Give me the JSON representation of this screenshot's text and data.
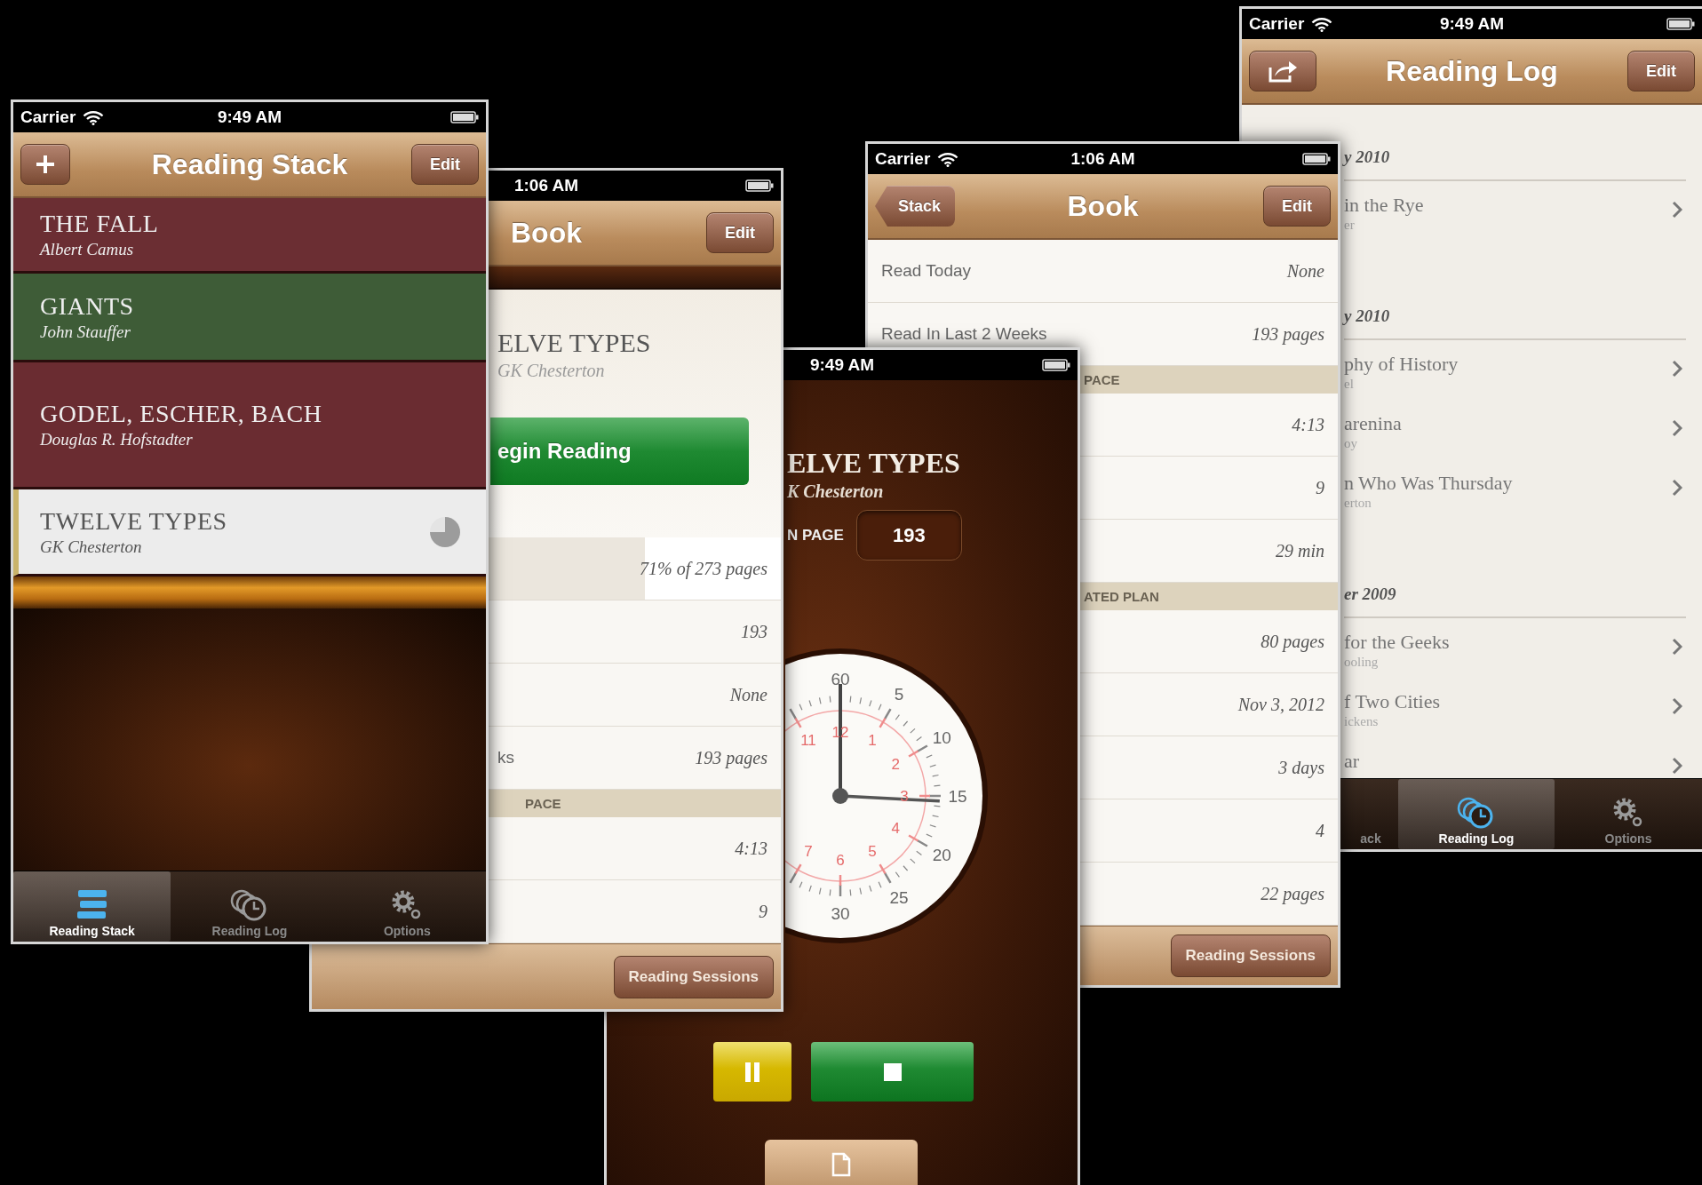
{
  "reading_stack": {
    "status": {
      "carrier": "Carrier",
      "time": "9:49 AM"
    },
    "nav": {
      "left": {
        "kind": "add"
      },
      "title": "Reading Stack",
      "right": "Edit"
    },
    "books": [
      {
        "title": "THE FALL",
        "author": "Albert Camus",
        "color": "#6b2e33",
        "selected": false
      },
      {
        "title": "GIANTS",
        "author": "John Stauffer",
        "color": "#3e5c37",
        "selected": false
      },
      {
        "title": "GODEL, ESCHER, BACH",
        "author": "Douglas R. Hofstadter",
        "color": "#6a2c31",
        "selected": false
      },
      {
        "title": "TWELVE TYPES",
        "author": "GK Chesterton",
        "color": "#ececec",
        "selected": true
      }
    ],
    "tabs": [
      {
        "kind": "stack",
        "label": "Reading Stack",
        "selected": true
      },
      {
        "kind": "log",
        "label": "Reading Log",
        "selected": false
      },
      {
        "kind": "options",
        "label": "Options",
        "selected": false
      }
    ]
  },
  "book_behind": {
    "status": {
      "time": "1:06 AM"
    },
    "nav": {
      "title": "Book",
      "right": "Edit"
    },
    "header": {
      "title": "ELVE TYPES",
      "author": "GK Chesterton"
    },
    "begin_button": "egin Reading",
    "rows": [
      {
        "kind": "progress",
        "value": "71% of 273 pages",
        "level": 0.71
      },
      {
        "kind": "row",
        "value": "193"
      },
      {
        "kind": "row",
        "value": "None"
      },
      {
        "kind": "row",
        "label": "ks",
        "value": "193 pages"
      },
      {
        "kind": "section",
        "label": "PACE"
      },
      {
        "kind": "row",
        "value": "4:13"
      },
      {
        "kind": "row",
        "value": "9"
      }
    ],
    "toolbar_button": "Reading Sessions"
  },
  "timer": {
    "status": {
      "time": "9:49 AM"
    },
    "title": "ELVE TYPES",
    "author": "K Chesterton",
    "page_label": "N PAGE",
    "page_value": "193",
    "minute_labels": [
      "60",
      "5",
      "10",
      "15",
      "20",
      "25",
      "30"
    ],
    "hour_labels": [
      "11",
      "12",
      "1",
      "2",
      "3",
      "4",
      "5",
      "6",
      "7"
    ]
  },
  "book": {
    "status": {
      "carrier": "Carrier",
      "time": "1:06 AM"
    },
    "nav": {
      "left": {
        "kind": "back",
        "label": "Stack"
      },
      "title": "Book",
      "right": "Edit"
    },
    "rows": [
      {
        "kind": "row",
        "label": "Read Today",
        "value": "None"
      },
      {
        "kind": "row",
        "label": "Read In Last 2 Weeks",
        "value": "193 pages"
      },
      {
        "kind": "section",
        "label": "PACE"
      },
      {
        "kind": "row",
        "value": "4:13"
      },
      {
        "kind": "row",
        "value": "9"
      },
      {
        "kind": "row",
        "value": "29 min"
      },
      {
        "kind": "section",
        "label": "ATED PLAN"
      },
      {
        "kind": "row",
        "value": "80 pages"
      },
      {
        "kind": "row",
        "value": "Nov 3, 2012"
      },
      {
        "kind": "row",
        "value": "3 days"
      },
      {
        "kind": "row",
        "value": "4"
      },
      {
        "kind": "row",
        "value": "22 pages"
      }
    ],
    "toolbar_button": "Reading Sessions"
  },
  "reading_log": {
    "status": {
      "carrier": "Carrier",
      "time": "9:49 AM"
    },
    "nav": {
      "left": {
        "kind": "share"
      },
      "title": "Reading Log",
      "right": "Edit"
    },
    "sections": [
      {
        "title": "y 2010",
        "rows": [
          {
            "title": "in the Rye",
            "subtitle": "er"
          }
        ]
      },
      {
        "title": "y 2010",
        "rows": [
          {
            "title": "phy of History",
            "subtitle": "el"
          },
          {
            "title": "arenina",
            "subtitle": "oy"
          },
          {
            "title": "n Who Was Thursday",
            "subtitle": "erton"
          }
        ]
      },
      {
        "title": "er 2009",
        "rows": [
          {
            "title": "for the Geeks",
            "subtitle": "ooling"
          },
          {
            "title": "f Two Cities",
            "subtitle": "ickens"
          },
          {
            "title": "ar"
          }
        ]
      }
    ],
    "tabs": [
      {
        "label": "ack",
        "selected": false
      },
      {
        "kind": "log",
        "label": "Reading Log",
        "selected": true
      },
      {
        "kind": "options",
        "label": "Options",
        "selected": false
      }
    ]
  }
}
